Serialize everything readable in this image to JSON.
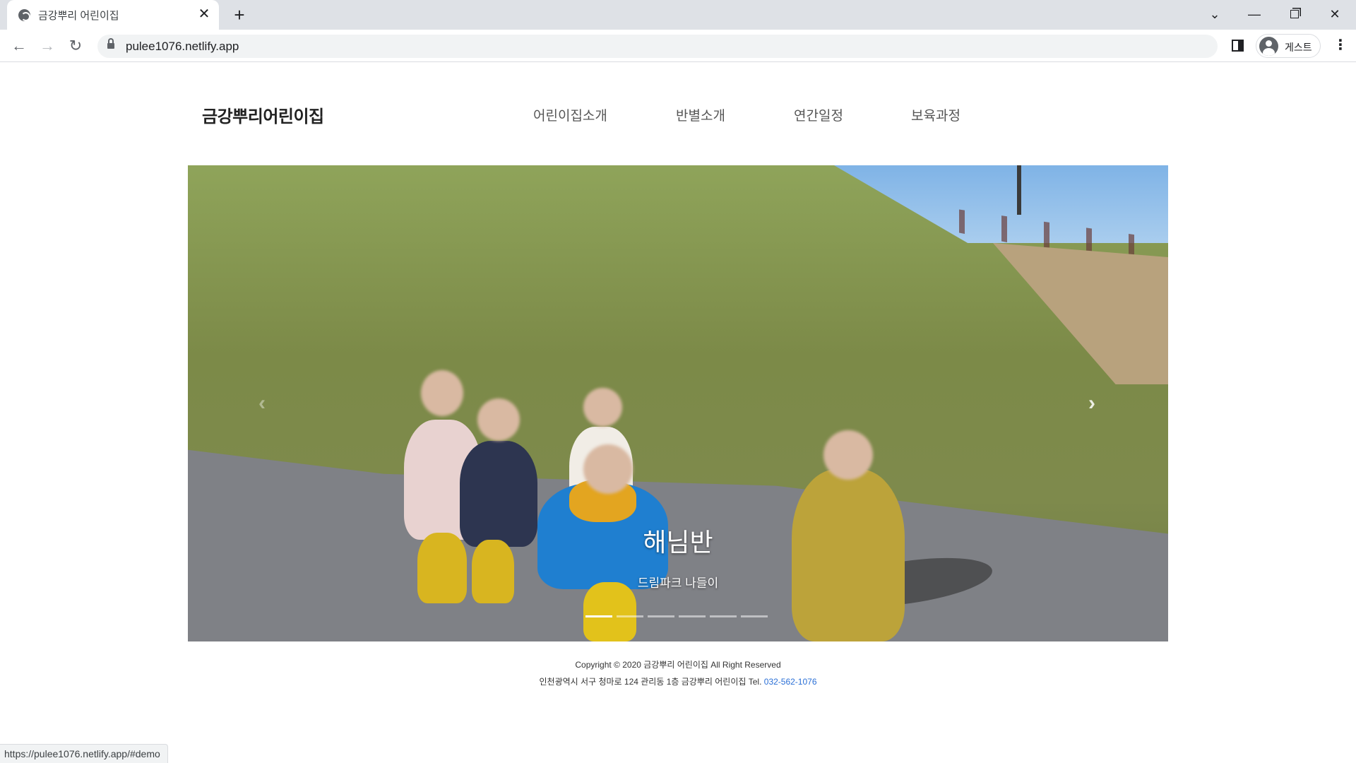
{
  "browser": {
    "tab_title": "금강뿌리 어린이집",
    "url": "pulee1076.netlify.app",
    "profile_label": "게스트",
    "status_url": "https://pulee1076.netlify.app/#demo"
  },
  "site": {
    "logo": "금강뿌리어린이집",
    "nav": [
      "어린이집소개",
      "반별소개",
      "연간일정",
      "보육과정"
    ]
  },
  "carousel": {
    "caption_title": "해님반",
    "caption_sub": "드림파크 나들이",
    "slide_count": 6,
    "active_index": 0,
    "prev_icon": "chevron-left-icon",
    "next_icon": "chevron-right-icon"
  },
  "footer": {
    "copyright": "Copyright © 2020 금강뿌리 어린이집 All Right Reserved",
    "address": "인천광역시 서구 청마로 124 관리동 1층 금강뿌리 어린이집 Tel. ",
    "phone": "032-562-1076",
    "phone_color": "#2a6fd6"
  }
}
